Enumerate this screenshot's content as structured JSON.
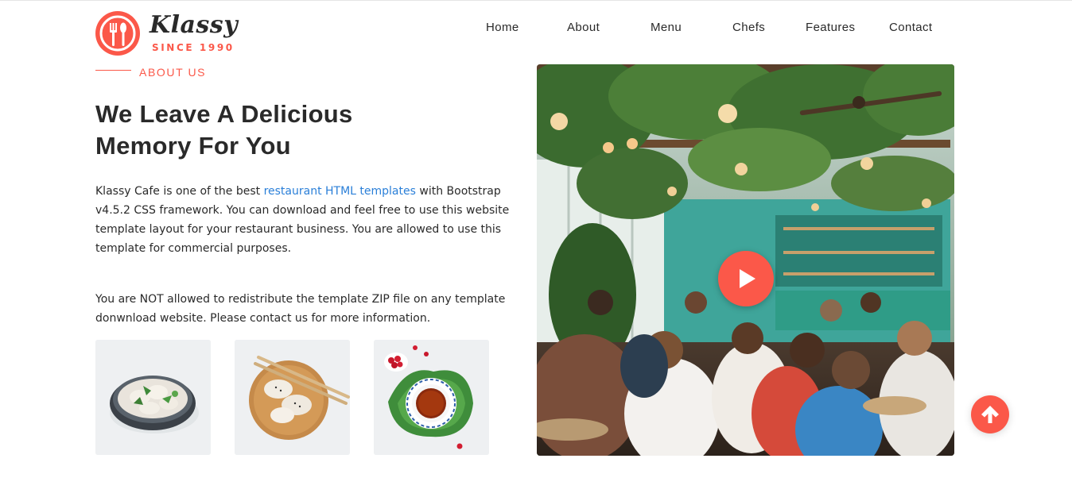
{
  "brand": {
    "name": "Klassy",
    "since": "SINCE 1990",
    "accent_color": "#fb5849",
    "logo_icon": "fork-and-spoon-icon"
  },
  "nav": {
    "items": [
      "Home",
      "About",
      "Menu",
      "Chefs",
      "Features",
      "Contact"
    ]
  },
  "about": {
    "eyebrow": "ABOUT US",
    "title_line1": "We Leave A Delicious",
    "title_line2": "Memory For You",
    "para1_before": "Klassy Cafe is one of the best ",
    "para1_link": "restaurant HTML templates",
    "para1_after": " with Bootstrap v4.5.2 CSS framework. You can download and feel free to use this website template layout for your restaurant business. You are allowed to use this template for commercial purposes.",
    "para2": "You are NOT allowed to redistribute the template ZIP file on any template donwnload website. Please contact us for more information.",
    "link_color": "#2a7fd8"
  },
  "thumbnails": [
    {
      "subject": "dumplings-bowl"
    },
    {
      "subject": "dumplings-wooden-plate"
    },
    {
      "subject": "tea-cup-leaves"
    }
  ],
  "video": {
    "play_icon": "play-icon",
    "scene": "restaurant-interior"
  },
  "back_to_top": {
    "icon": "arrow-up-icon"
  }
}
